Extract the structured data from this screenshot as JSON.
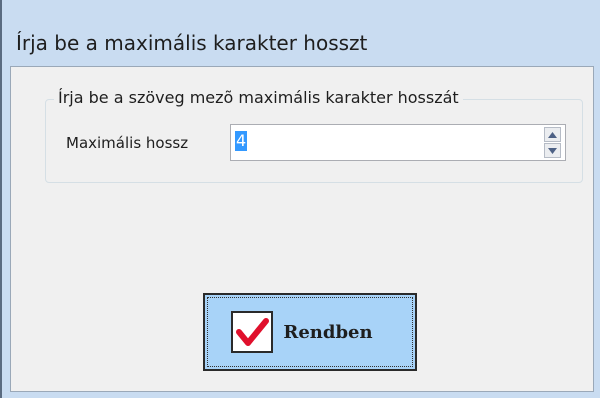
{
  "dialog": {
    "title": "Írja be a maximális karakter hosszt",
    "group_label": "Írja be a szöveg mezõ maximális karakter hosszát",
    "field_label": "Maximális hossz",
    "field_value": "4",
    "ok_label": "Rendben"
  },
  "colors": {
    "window_frame": "#c9dcf1",
    "client_bg": "#f0f0f0",
    "button_bg": "#a8d3f8",
    "check_mark": "#e0102c",
    "selection": "#3399ff"
  },
  "icons": {
    "spin_up": "triangle-up-icon",
    "spin_down": "triangle-down-icon",
    "ok": "red-checkmark-icon"
  }
}
